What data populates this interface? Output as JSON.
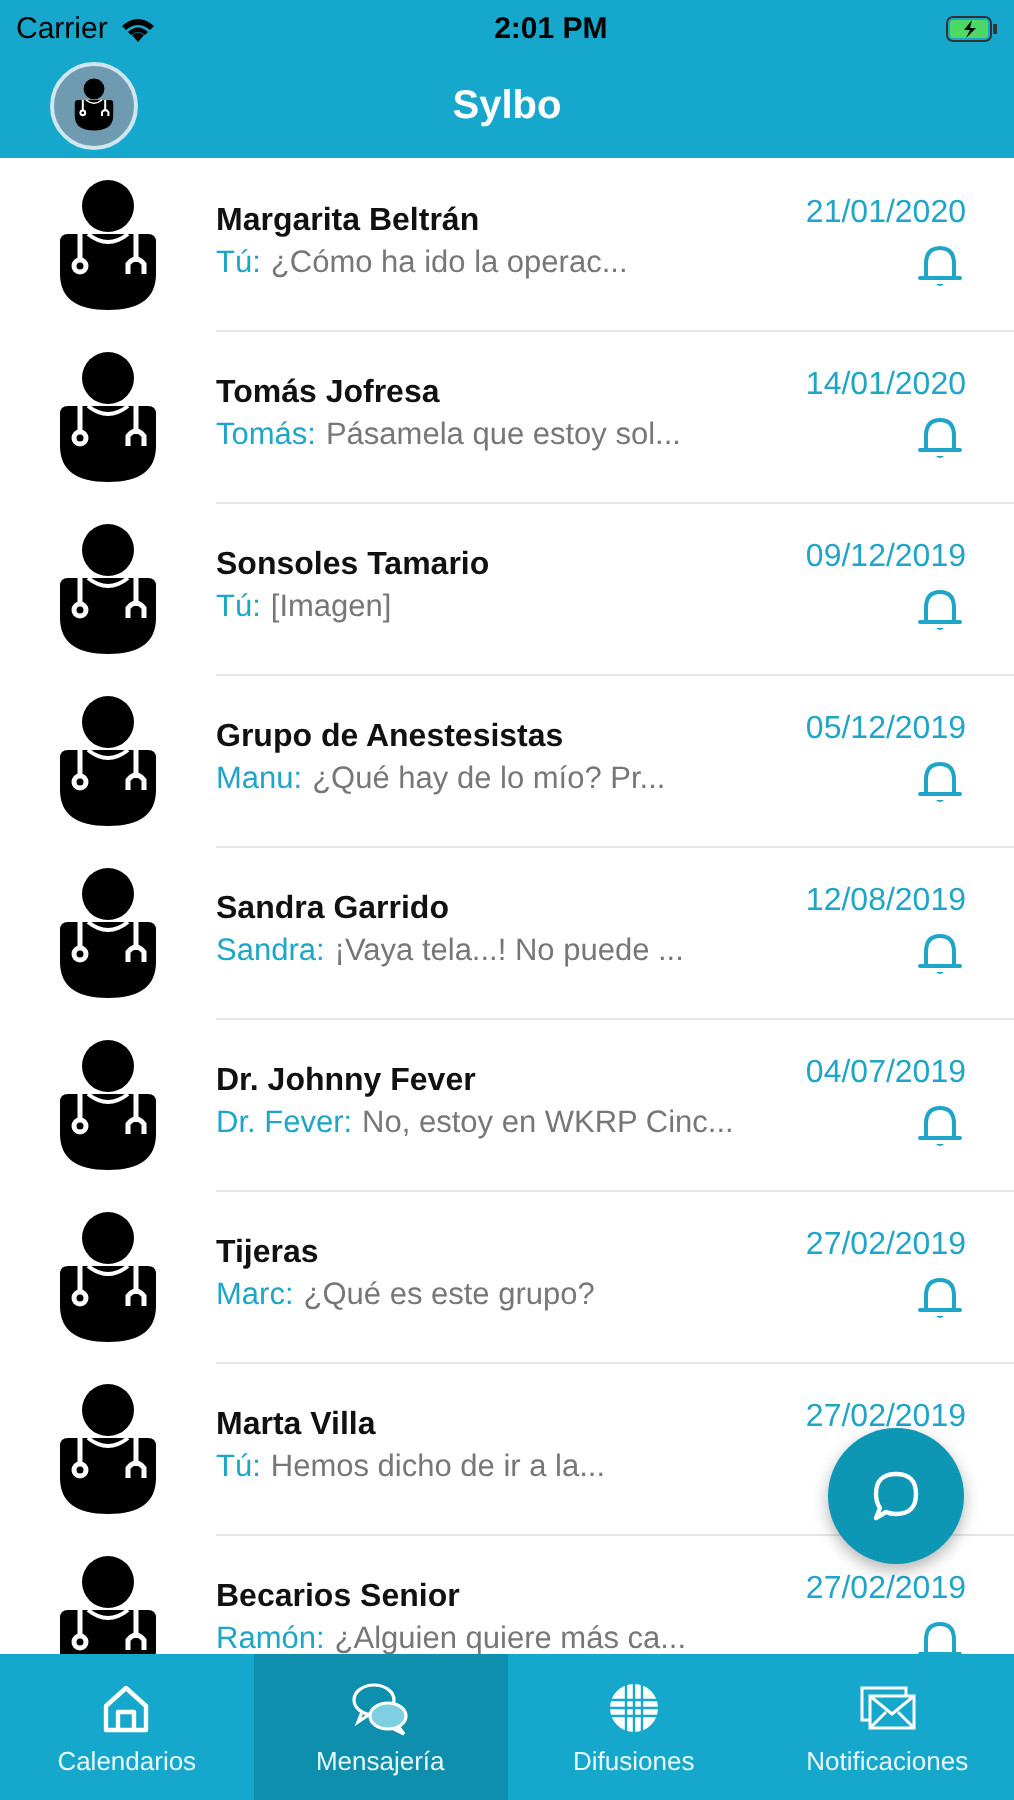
{
  "status_bar": {
    "carrier": "Carrier",
    "time": "2:01 PM"
  },
  "header": {
    "title": "Sylbo"
  },
  "chats": [
    {
      "name": "Margarita Beltrán",
      "sender": "Tú:",
      "message": "¿Cómo ha ido la operac...",
      "date": "21/01/2020"
    },
    {
      "name": "Tomás Jofresa",
      "sender": "Tomás:",
      "message": "Pásamela que estoy sol...",
      "date": "14/01/2020"
    },
    {
      "name": "Sonsoles Tamario",
      "sender": "Tú:",
      "message": "[Imagen]",
      "date": "09/12/2019"
    },
    {
      "name": "Grupo de Anestesistas",
      "sender": "Manu:",
      "message": "¿Qué hay de lo mío? Pr...",
      "date": "05/12/2019"
    },
    {
      "name": "Sandra Garrido",
      "sender": "Sandra:",
      "message": "¡Vaya tela...! No puede ...",
      "date": "12/08/2019"
    },
    {
      "name": "Dr. Johnny Fever",
      "sender": "Dr. Fever:",
      "message": "No, estoy en WKRP Cinc...",
      "date": "04/07/2019"
    },
    {
      "name": "Tijeras",
      "sender": "Marc:",
      "message": "¿Qué es este grupo?",
      "date": "27/02/2019"
    },
    {
      "name": "Marta Villa",
      "sender": "Tú:",
      "message": "Hemos dicho de ir a la...",
      "date": "27/02/2019",
      "bell": false
    },
    {
      "name": "Becarios Senior",
      "sender": "Ramón:",
      "message": "¿Alguien quiere más ca...",
      "date": "27/02/2019"
    }
  ],
  "tabs": [
    {
      "label": "Calendarios",
      "kind": "home",
      "selected": false
    },
    {
      "label": "Mensajería",
      "kind": "chat",
      "selected": true
    },
    {
      "label": "Difusiones",
      "kind": "globe",
      "selected": false
    },
    {
      "label": "Notificaciones",
      "kind": "mail",
      "selected": false
    }
  ]
}
